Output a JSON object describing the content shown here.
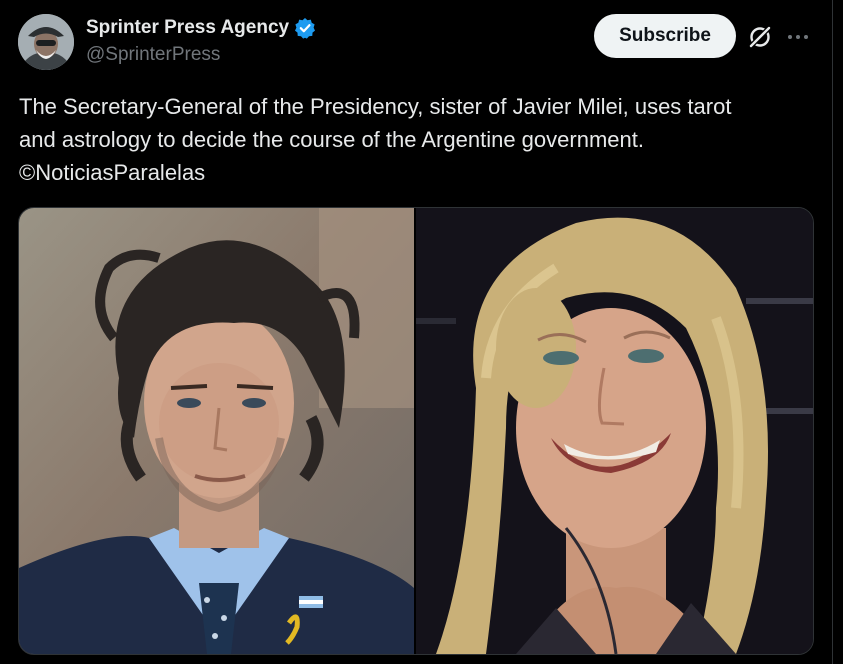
{
  "author": {
    "name": "Sprinter Press Agency",
    "handle": "@SprinterPress",
    "verified": true,
    "avatar": "avatar-photo"
  },
  "actions": {
    "subscribe_label": "Subscribe",
    "grok_icon": "grok-icon",
    "more_icon": "more-options-icon"
  },
  "tweet": {
    "text_lines": [
      "The Secretary-General of the Presidency, sister of Javier Milei, uses tarot",
      "and astrology to decide the course of the Argentine government.",
      "©NoticiasParalelas"
    ]
  },
  "media": {
    "photos": [
      "photo-left",
      "photo-right"
    ]
  },
  "colors": {
    "background": "#000000",
    "text": "#e7e9ea",
    "secondary_text": "#71767b",
    "verified_blue": "#1d9bf0",
    "button_bg": "#eff3f4",
    "border": "#2f3336"
  }
}
